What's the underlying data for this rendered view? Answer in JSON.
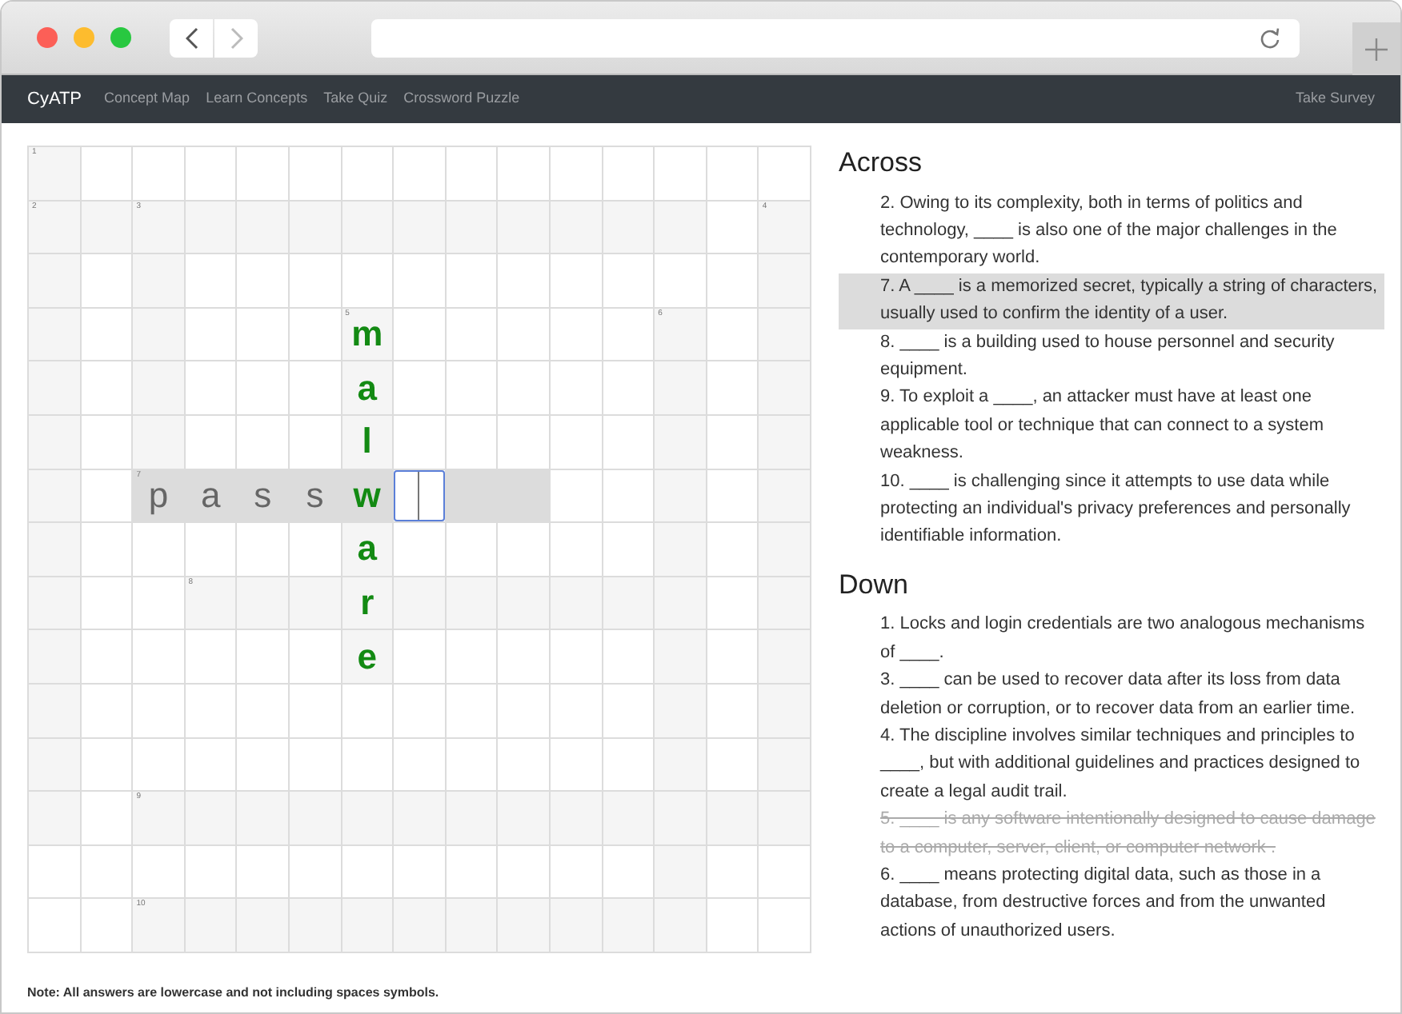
{
  "browser": {
    "back_enabled": true,
    "forward_enabled": false
  },
  "navbar": {
    "brand": "CyATP",
    "links": [
      {
        "label": "Concept Map"
      },
      {
        "label": "Learn Concepts"
      },
      {
        "label": "Take Quiz"
      },
      {
        "label": "Crossword Puzzle"
      }
    ],
    "right_link": "Take Survey"
  },
  "puzzle": {
    "rows": [
      [
        {
          "kind": "open",
          "number": "1"
        },
        {
          "kind": "block"
        },
        {
          "kind": "block"
        },
        {
          "kind": "block"
        },
        {
          "kind": "block"
        },
        {
          "kind": "block"
        },
        {
          "kind": "block"
        },
        {
          "kind": "block"
        },
        {
          "kind": "block"
        },
        {
          "kind": "block"
        },
        {
          "kind": "block"
        },
        {
          "kind": "block"
        },
        {
          "kind": "block"
        },
        {
          "kind": "block"
        },
        {
          "kind": "block"
        }
      ],
      [
        {
          "kind": "open",
          "number": "2"
        },
        {
          "kind": "open"
        },
        {
          "kind": "open",
          "number": "3"
        },
        {
          "kind": "open"
        },
        {
          "kind": "open"
        },
        {
          "kind": "open"
        },
        {
          "kind": "open"
        },
        {
          "kind": "open"
        },
        {
          "kind": "open"
        },
        {
          "kind": "open"
        },
        {
          "kind": "open"
        },
        {
          "kind": "open"
        },
        {
          "kind": "open"
        },
        {
          "kind": "block"
        },
        {
          "kind": "open",
          "number": "4"
        }
      ],
      [
        {
          "kind": "open"
        },
        {
          "kind": "block"
        },
        {
          "kind": "open"
        },
        {
          "kind": "block"
        },
        {
          "kind": "block"
        },
        {
          "kind": "block"
        },
        {
          "kind": "block"
        },
        {
          "kind": "block"
        },
        {
          "kind": "block"
        },
        {
          "kind": "block"
        },
        {
          "kind": "block"
        },
        {
          "kind": "block"
        },
        {
          "kind": "block"
        },
        {
          "kind": "block"
        },
        {
          "kind": "open"
        }
      ],
      [
        {
          "kind": "open"
        },
        {
          "kind": "block"
        },
        {
          "kind": "open"
        },
        {
          "kind": "block"
        },
        {
          "kind": "block"
        },
        {
          "kind": "block"
        },
        {
          "kind": "open",
          "number": "5",
          "letter": "m",
          "correct": true
        },
        {
          "kind": "block"
        },
        {
          "kind": "block"
        },
        {
          "kind": "block"
        },
        {
          "kind": "block"
        },
        {
          "kind": "block"
        },
        {
          "kind": "open",
          "number": "6"
        },
        {
          "kind": "block"
        },
        {
          "kind": "open"
        }
      ],
      [
        {
          "kind": "open"
        },
        {
          "kind": "block"
        },
        {
          "kind": "open"
        },
        {
          "kind": "block"
        },
        {
          "kind": "block"
        },
        {
          "kind": "block"
        },
        {
          "kind": "open",
          "letter": "a",
          "correct": true
        },
        {
          "kind": "block"
        },
        {
          "kind": "block"
        },
        {
          "kind": "block"
        },
        {
          "kind": "block"
        },
        {
          "kind": "block"
        },
        {
          "kind": "open"
        },
        {
          "kind": "block"
        },
        {
          "kind": "open"
        }
      ],
      [
        {
          "kind": "open"
        },
        {
          "kind": "block"
        },
        {
          "kind": "open"
        },
        {
          "kind": "block"
        },
        {
          "kind": "block"
        },
        {
          "kind": "block"
        },
        {
          "kind": "open",
          "letter": "l",
          "correct": true
        },
        {
          "kind": "block"
        },
        {
          "kind": "block"
        },
        {
          "kind": "block"
        },
        {
          "kind": "block"
        },
        {
          "kind": "block"
        },
        {
          "kind": "open"
        },
        {
          "kind": "block"
        },
        {
          "kind": "open"
        }
      ],
      [
        {
          "kind": "open"
        },
        {
          "kind": "block"
        },
        {
          "kind": "highlight",
          "number": "7",
          "letter": "p",
          "correct": false
        },
        {
          "kind": "highlight",
          "letter": "a",
          "correct": false
        },
        {
          "kind": "highlight",
          "letter": "s",
          "correct": false
        },
        {
          "kind": "highlight",
          "letter": "s",
          "correct": false
        },
        {
          "kind": "highlight",
          "letter": "w",
          "correct": true
        },
        {
          "kind": "input"
        },
        {
          "kind": "highlight"
        },
        {
          "kind": "highlight"
        },
        {
          "kind": "block"
        },
        {
          "kind": "block"
        },
        {
          "kind": "open"
        },
        {
          "kind": "block"
        },
        {
          "kind": "open"
        }
      ],
      [
        {
          "kind": "open"
        },
        {
          "kind": "block"
        },
        {
          "kind": "block"
        },
        {
          "kind": "block"
        },
        {
          "kind": "block"
        },
        {
          "kind": "block"
        },
        {
          "kind": "open",
          "letter": "a",
          "correct": true
        },
        {
          "kind": "block"
        },
        {
          "kind": "block"
        },
        {
          "kind": "block"
        },
        {
          "kind": "block"
        },
        {
          "kind": "block"
        },
        {
          "kind": "open"
        },
        {
          "kind": "block"
        },
        {
          "kind": "open"
        }
      ],
      [
        {
          "kind": "open"
        },
        {
          "kind": "block"
        },
        {
          "kind": "block"
        },
        {
          "kind": "open",
          "number": "8"
        },
        {
          "kind": "open"
        },
        {
          "kind": "open"
        },
        {
          "kind": "open",
          "letter": "r",
          "correct": true
        },
        {
          "kind": "open"
        },
        {
          "kind": "open"
        },
        {
          "kind": "open"
        },
        {
          "kind": "open"
        },
        {
          "kind": "open"
        },
        {
          "kind": "open"
        },
        {
          "kind": "block"
        },
        {
          "kind": "open"
        }
      ],
      [
        {
          "kind": "open"
        },
        {
          "kind": "block"
        },
        {
          "kind": "block"
        },
        {
          "kind": "block"
        },
        {
          "kind": "block"
        },
        {
          "kind": "block"
        },
        {
          "kind": "open",
          "letter": "e",
          "correct": true
        },
        {
          "kind": "block"
        },
        {
          "kind": "block"
        },
        {
          "kind": "block"
        },
        {
          "kind": "block"
        },
        {
          "kind": "block"
        },
        {
          "kind": "open"
        },
        {
          "kind": "block"
        },
        {
          "kind": "open"
        }
      ],
      [
        {
          "kind": "open"
        },
        {
          "kind": "block"
        },
        {
          "kind": "block"
        },
        {
          "kind": "block"
        },
        {
          "kind": "block"
        },
        {
          "kind": "block"
        },
        {
          "kind": "block"
        },
        {
          "kind": "block"
        },
        {
          "kind": "block"
        },
        {
          "kind": "block"
        },
        {
          "kind": "block"
        },
        {
          "kind": "block"
        },
        {
          "kind": "open"
        },
        {
          "kind": "block"
        },
        {
          "kind": "open"
        }
      ],
      [
        {
          "kind": "open"
        },
        {
          "kind": "block"
        },
        {
          "kind": "block"
        },
        {
          "kind": "block"
        },
        {
          "kind": "block"
        },
        {
          "kind": "block"
        },
        {
          "kind": "block"
        },
        {
          "kind": "block"
        },
        {
          "kind": "block"
        },
        {
          "kind": "block"
        },
        {
          "kind": "block"
        },
        {
          "kind": "block"
        },
        {
          "kind": "open"
        },
        {
          "kind": "block"
        },
        {
          "kind": "open"
        }
      ],
      [
        {
          "kind": "open"
        },
        {
          "kind": "block"
        },
        {
          "kind": "open",
          "number": "9"
        },
        {
          "kind": "open"
        },
        {
          "kind": "open"
        },
        {
          "kind": "open"
        },
        {
          "kind": "open"
        },
        {
          "kind": "open"
        },
        {
          "kind": "open"
        },
        {
          "kind": "open"
        },
        {
          "kind": "open"
        },
        {
          "kind": "open"
        },
        {
          "kind": "open"
        },
        {
          "kind": "open"
        },
        {
          "kind": "open"
        }
      ],
      [
        {
          "kind": "block"
        },
        {
          "kind": "block"
        },
        {
          "kind": "block"
        },
        {
          "kind": "block"
        },
        {
          "kind": "block"
        },
        {
          "kind": "block"
        },
        {
          "kind": "block"
        },
        {
          "kind": "block"
        },
        {
          "kind": "block"
        },
        {
          "kind": "block"
        },
        {
          "kind": "block"
        },
        {
          "kind": "block"
        },
        {
          "kind": "open"
        },
        {
          "kind": "block"
        },
        {
          "kind": "block"
        }
      ],
      [
        {
          "kind": "block"
        },
        {
          "kind": "block"
        },
        {
          "kind": "open",
          "number": "10"
        },
        {
          "kind": "open"
        },
        {
          "kind": "open"
        },
        {
          "kind": "open"
        },
        {
          "kind": "open"
        },
        {
          "kind": "open"
        },
        {
          "kind": "open"
        },
        {
          "kind": "open"
        },
        {
          "kind": "open"
        },
        {
          "kind": "open"
        },
        {
          "kind": "open"
        },
        {
          "kind": "block"
        },
        {
          "kind": "block"
        }
      ]
    ]
  },
  "note": "Note: All answers are lowercase and not including spaces symbols.",
  "clues": [
    {
      "heading": "Across",
      "items": [
        {
          "text": "2. Owing to its complexity, both in terms of politics and technology, ____ is also one of the major challenges in the contemporary world.",
          "selected": false,
          "solved": false
        },
        {
          "text": "7. A ____ is a memorized secret, typically a string of characters, usually used to confirm the identity of a user.",
          "selected": true,
          "solved": false
        },
        {
          "text": "8. ____ is a building used to house personnel and security equipment.",
          "selected": false,
          "solved": false
        },
        {
          "text": "9. To exploit a ____, an attacker must have at least one applicable tool or technique that can connect to a system weakness.",
          "selected": false,
          "solved": false
        },
        {
          "text": "10. ____ is challenging since it attempts to use data while protecting an individual's privacy preferences and personally identifiable information.",
          "selected": false,
          "solved": false
        }
      ]
    },
    {
      "heading": "Down",
      "items": [
        {
          "text": "1. Locks and login credentials are two analogous mechanisms of ____.",
          "selected": false,
          "solved": false
        },
        {
          "text": "3. ____ can be used to recover data after its loss from data deletion or corruption, or to recover data from an earlier time.",
          "selected": false,
          "solved": false
        },
        {
          "text": "4. The discipline involves similar techniques and principles to ____, but with additional guidelines and practices designed to create a legal audit trail.",
          "selected": false,
          "solved": false
        },
        {
          "text": "5. ____ is any software intentionally designed to cause damage to a computer, server, client, or computer network .",
          "selected": false,
          "solved": true
        },
        {
          "text": "6. ____ means protecting digital data, such as those in a database, from destructive forces and from the unwanted actions of unauthorized users.",
          "selected": false,
          "solved": false
        }
      ]
    }
  ]
}
